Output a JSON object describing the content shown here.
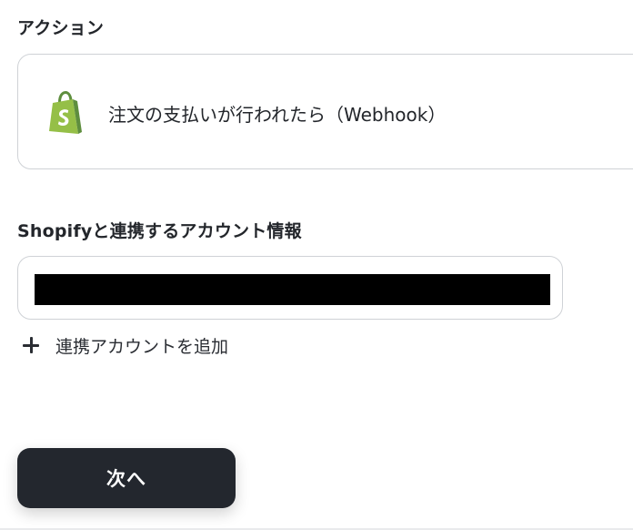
{
  "action_section": {
    "title": "アクション",
    "selected_action": {
      "app_icon": "shopify-bag-icon",
      "label": "注文の支払いが行われたら（Webhook）"
    }
  },
  "account_section": {
    "title": "Shopifyと連携するアカウント情報",
    "selected_account": "",
    "add_account_label": "連携アカウントを追加",
    "add_icon": "plus-icon"
  },
  "footer": {
    "next_label": "次へ"
  },
  "colors": {
    "shopify_green": "#95BF47",
    "shopify_dark_green": "#5E8E3E",
    "button_background": "#23272E",
    "border": "#CFD2D6",
    "text": "#23262B"
  }
}
